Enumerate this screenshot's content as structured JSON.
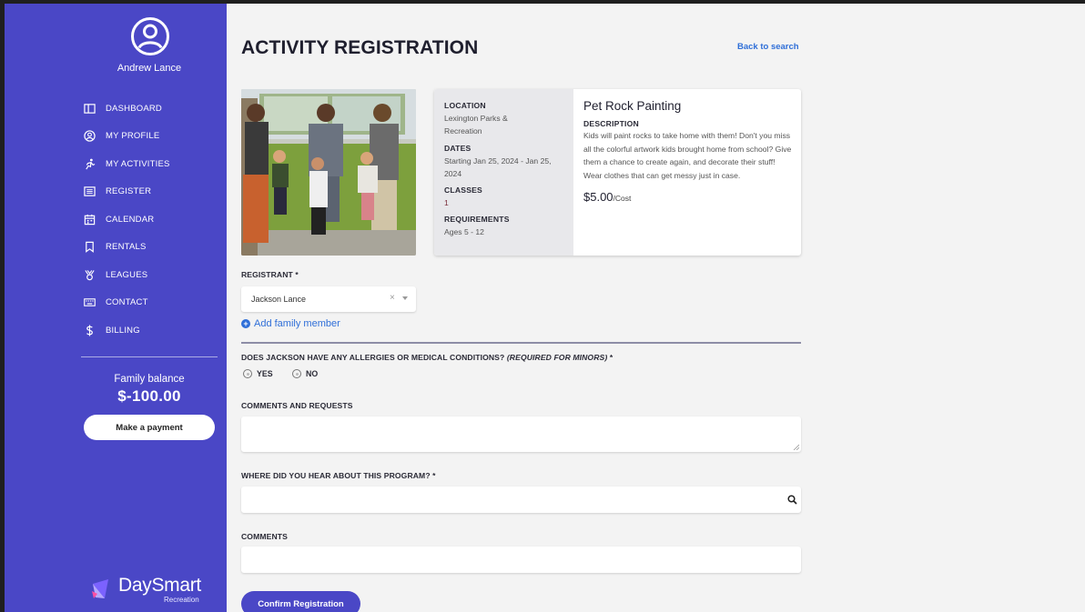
{
  "user": {
    "name": "Andrew Lance"
  },
  "nav": [
    {
      "label": "DASHBOARD",
      "icon": "dashboard-icon"
    },
    {
      "label": "MY PROFILE",
      "icon": "profile-icon"
    },
    {
      "label": "MY ACTIVITIES",
      "icon": "activity-icon"
    },
    {
      "label": "REGISTER",
      "icon": "register-icon"
    },
    {
      "label": "CALENDAR",
      "icon": "calendar-icon"
    },
    {
      "label": "RENTALS",
      "icon": "bookmark-icon"
    },
    {
      "label": "LEAGUES",
      "icon": "medal-icon"
    },
    {
      "label": "CONTACT",
      "icon": "keyboard-icon"
    },
    {
      "label": "BILLING",
      "icon": "dollar-icon"
    }
  ],
  "balance": {
    "label": "Family balance",
    "value": "$-100.00"
  },
  "pay_button": "Make a payment",
  "logo": {
    "name": "DaySmart",
    "sub": "Recreation"
  },
  "page": {
    "title": "ACTIVITY REGISTRATION",
    "back_link": "Back to search"
  },
  "activity": {
    "location_label": "LOCATION",
    "location": "Lexington Parks & Recreation",
    "dates_label": "DATES",
    "dates": "Starting Jan 25, 2024 - Jan 25, 2024",
    "classes_label": "CLASSES",
    "classes": "1",
    "requirements_label": "REQUIREMENTS",
    "requirements": "Ages 5 - 12",
    "title": "Pet Rock Painting",
    "description_label": "DESCRIPTION",
    "description": "Kids will paint rocks to take home with them! Don't you miss all the colorful artwork kids brought home from school? Give them a chance to create again, and decorate their stuff! Wear clothes that can get messy just in case.",
    "price": "$5.00",
    "price_unit": "/Cost"
  },
  "form": {
    "registrant_label": "REGISTRANT *",
    "registrant_value": "Jackson Lance",
    "clear_symbol": "×",
    "add_family": "Add family member",
    "allergy_question": "DOES JACKSON HAVE ANY ALLERGIES OR MEDICAL CONDITIONS?",
    "allergy_required": "(REQUIRED FOR MINORS)",
    "allergy_star": " *",
    "yes": "YES",
    "no": "NO",
    "comments_requests_label": "COMMENTS AND REQUESTS",
    "hear_label": "WHERE DID YOU HEAR ABOUT THIS PROGRAM? *",
    "comments_label": "COMMENTS",
    "confirm_button": "Confirm Registration"
  }
}
